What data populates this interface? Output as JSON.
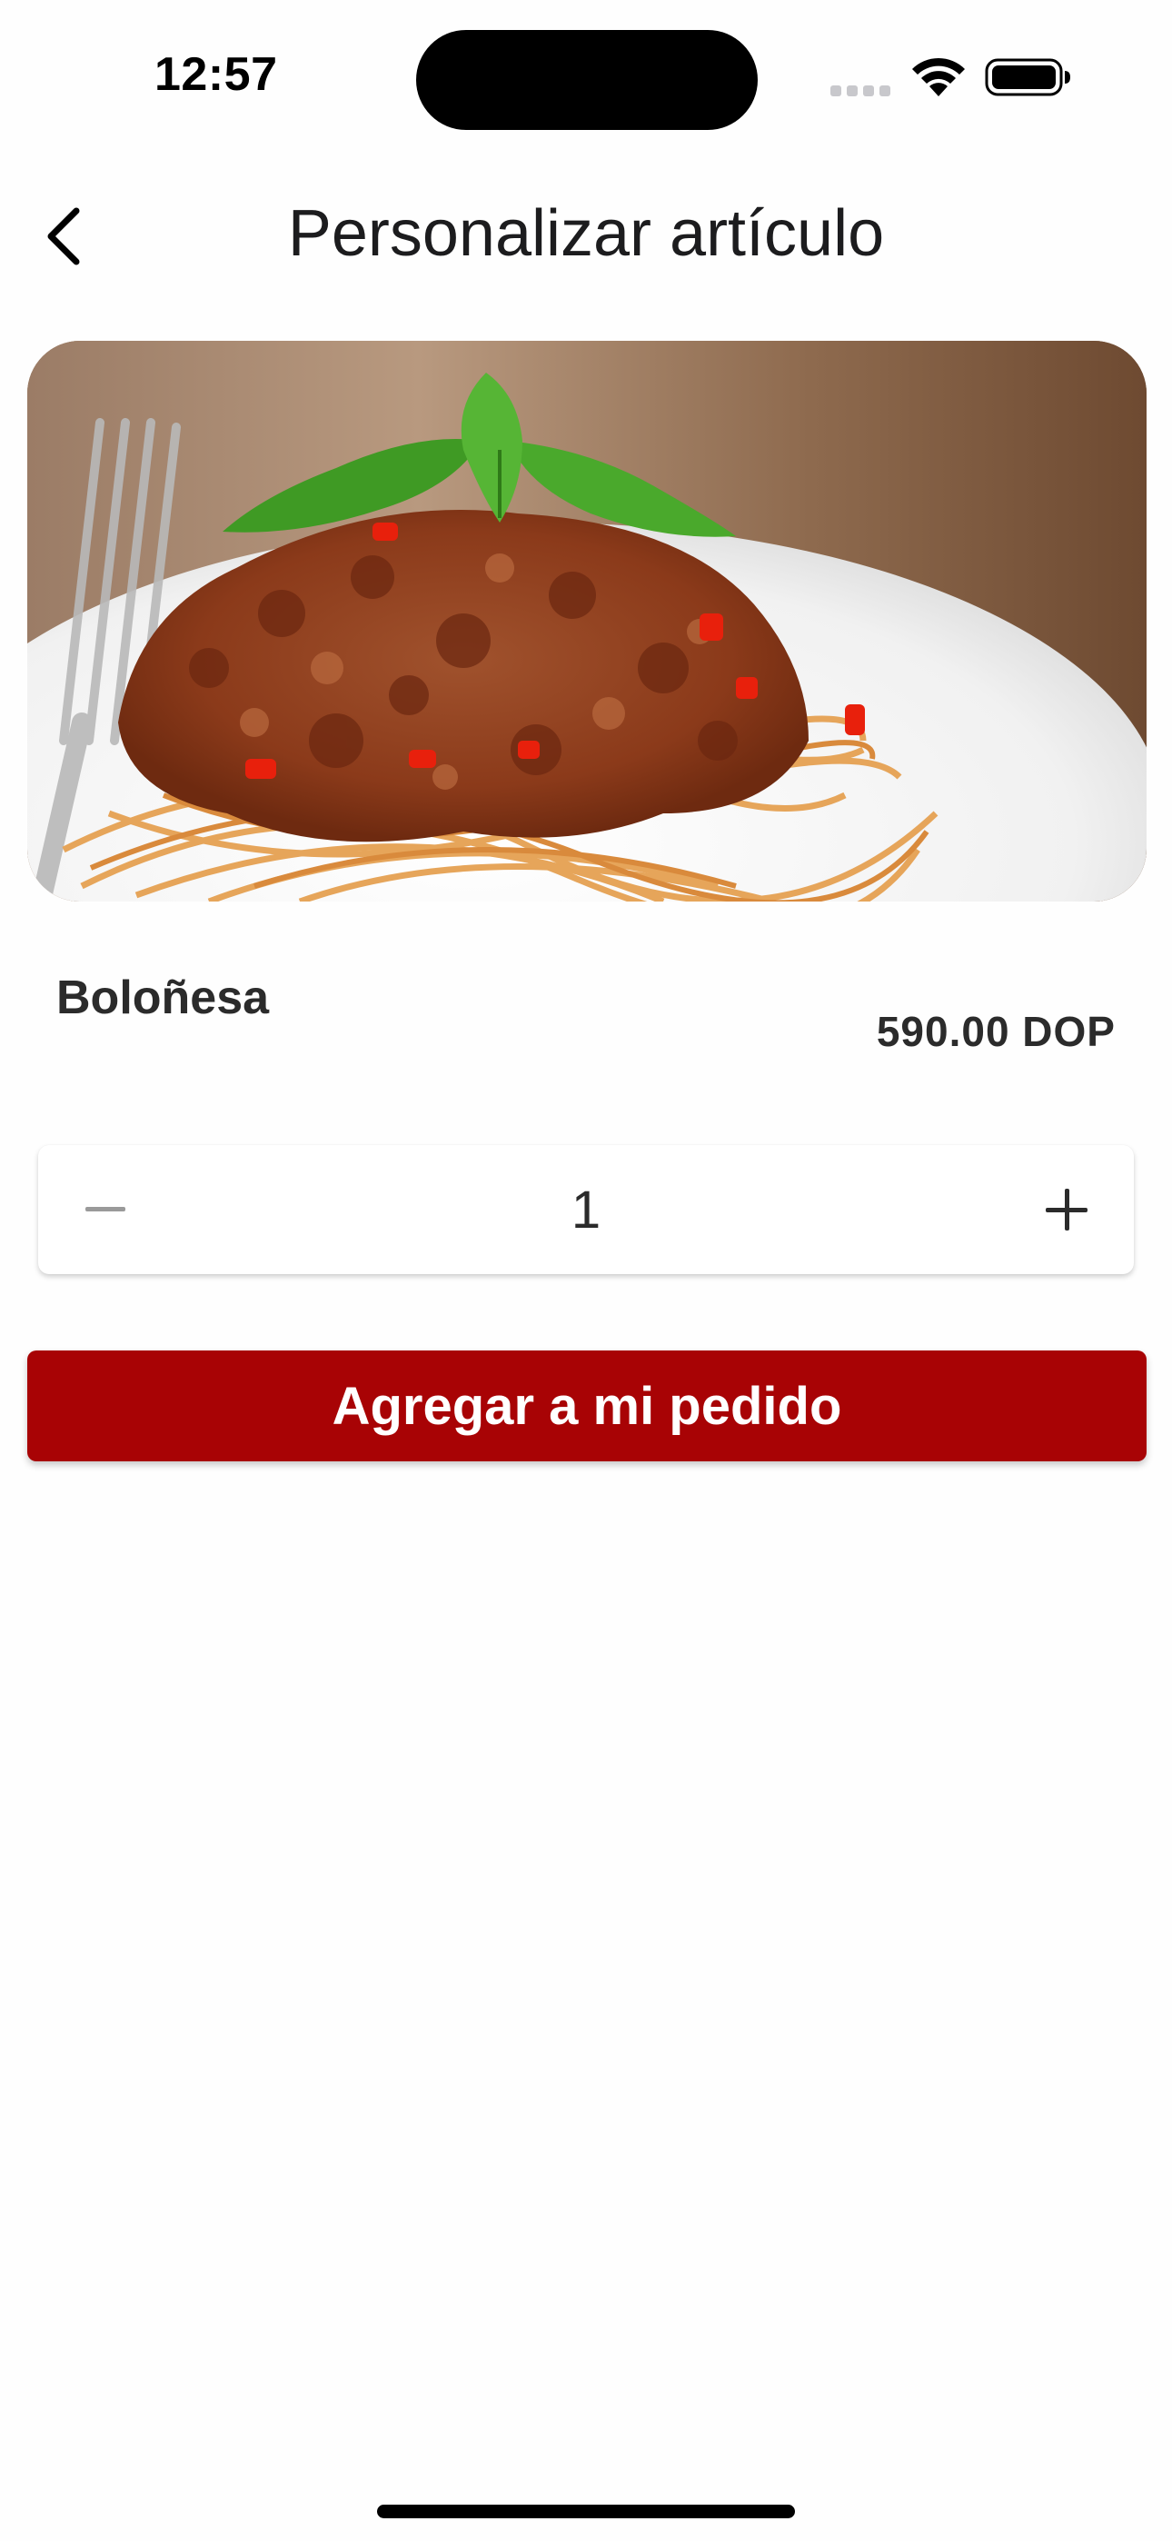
{
  "status_bar": {
    "time": "12:57"
  },
  "nav": {
    "title": "Personalizar artículo"
  },
  "product": {
    "name": "Boloñesa",
    "price": "590.00 DOP"
  },
  "quantity": {
    "value": "1"
  },
  "actions": {
    "add_label": "Agregar a mi pedido"
  },
  "colors": {
    "accent": "#a80305",
    "text": "#2b2b2b"
  },
  "icons": {
    "back": "chevron-left-icon",
    "minus": "minus-icon",
    "plus": "plus-icon",
    "signal": "cellular-signal-icon",
    "wifi": "wifi-icon",
    "battery": "battery-icon"
  }
}
